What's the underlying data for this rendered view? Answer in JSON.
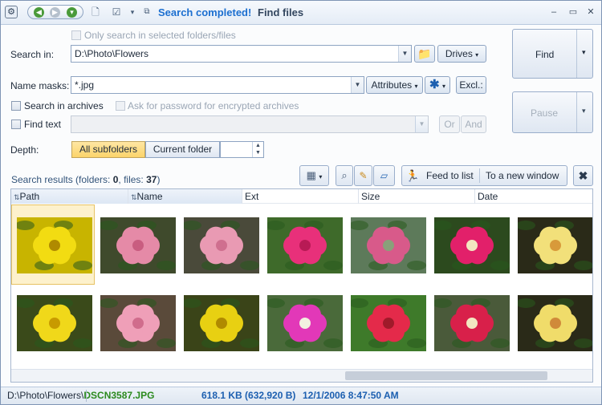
{
  "window": {
    "status_title": "Search completed!",
    "app_title": "Find files",
    "minimize_glyph": "–",
    "restore_glyph": "▭",
    "close_glyph": "✕"
  },
  "form": {
    "only_selected_label": "Only search in selected folders/files",
    "search_in_label": "Search in:",
    "search_in_value": "D:\\Photo\\Flowers",
    "drives_label": "Drives",
    "name_masks_label": "Name masks:",
    "name_masks_value": "*.jpg",
    "attributes_label": "Attributes",
    "excl_label": "Excl.:",
    "search_archives_label": "Search in archives",
    "ask_password_label": "Ask for password for encrypted archives",
    "find_text_label": "Find text",
    "find_text_value": "",
    "or_label": "Or",
    "and_label": "And",
    "depth_label": "Depth:",
    "depth_all": "All subfolders",
    "depth_current": "Current folder",
    "depth_value": ""
  },
  "actions": {
    "find_label": "Find",
    "pause_label": "Pause"
  },
  "results": {
    "prefix": "Search results (folders: ",
    "folders": "0",
    "mid": ", files: ",
    "files": "37",
    "suffix": ")",
    "feed_to_list": "Feed to list",
    "new_window": "To a new window"
  },
  "columns": [
    "Path",
    "Name",
    "Ext",
    "Size",
    "Date"
  ],
  "thumbnails": [
    {
      "name": "yellow-flower-1",
      "bg": "#c8b400",
      "petal": "#f2dc12",
      "center": "#b08a00",
      "selected": true
    },
    {
      "name": "pink-rose-1",
      "bg": "#3f4a2c",
      "petal": "#e58aa7",
      "center": "#c95d80",
      "selected": false
    },
    {
      "name": "pink-rose-2",
      "bg": "#4a4a3a",
      "petal": "#e99ab3",
      "center": "#cf6f8f",
      "selected": false
    },
    {
      "name": "pink-hibiscus-1",
      "bg": "#3e6a2a",
      "petal": "#e8307a",
      "center": "#b81a55",
      "selected": false
    },
    {
      "name": "small-pink-bud",
      "bg": "#5d7a5a",
      "petal": "#d85a8a",
      "center": "#8aa07a",
      "selected": false
    },
    {
      "name": "bougainvillea-1",
      "bg": "#2c4a1e",
      "petal": "#e2206a",
      "center": "#f2e7c0",
      "selected": false
    },
    {
      "name": "lantana-yellow-1",
      "bg": "#2a2a18",
      "petal": "#f2e07a",
      "center": "#d89a3a",
      "selected": false
    },
    {
      "name": "yellow-flower-2",
      "bg": "#3a4a1a",
      "petal": "#f0d81a",
      "center": "#c89a00",
      "selected": false
    },
    {
      "name": "pink-rose-3",
      "bg": "#5a4a3a",
      "petal": "#ef9fb8",
      "center": "#d06c8c",
      "selected": false
    },
    {
      "name": "yellow-flower-3",
      "bg": "#3a4418",
      "petal": "#e8d012",
      "center": "#b08a00",
      "selected": false
    },
    {
      "name": "pink-hibiscus-2",
      "bg": "#4a6a3a",
      "petal": "#e238b8",
      "center": "#f2f0e0",
      "selected": false
    },
    {
      "name": "red-hibiscus",
      "bg": "#3e7a2a",
      "petal": "#e42a4a",
      "center": "#a01a2a",
      "selected": false
    },
    {
      "name": "bougainvillea-2",
      "bg": "#4a5a3a",
      "petal": "#d8204a",
      "center": "#f2e7c0",
      "selected": false
    },
    {
      "name": "lantana-yellow-2",
      "bg": "#2a2a18",
      "petal": "#f0dc6a",
      "center": "#d08a3a",
      "selected": false
    }
  ],
  "statusbar": {
    "path": "D:\\Photo\\Flowers\\",
    "file": "DSCN3587.JPG",
    "size": "618.1 KB (632,920 B)",
    "date": "12/1/2006 8:47:50 AM"
  }
}
